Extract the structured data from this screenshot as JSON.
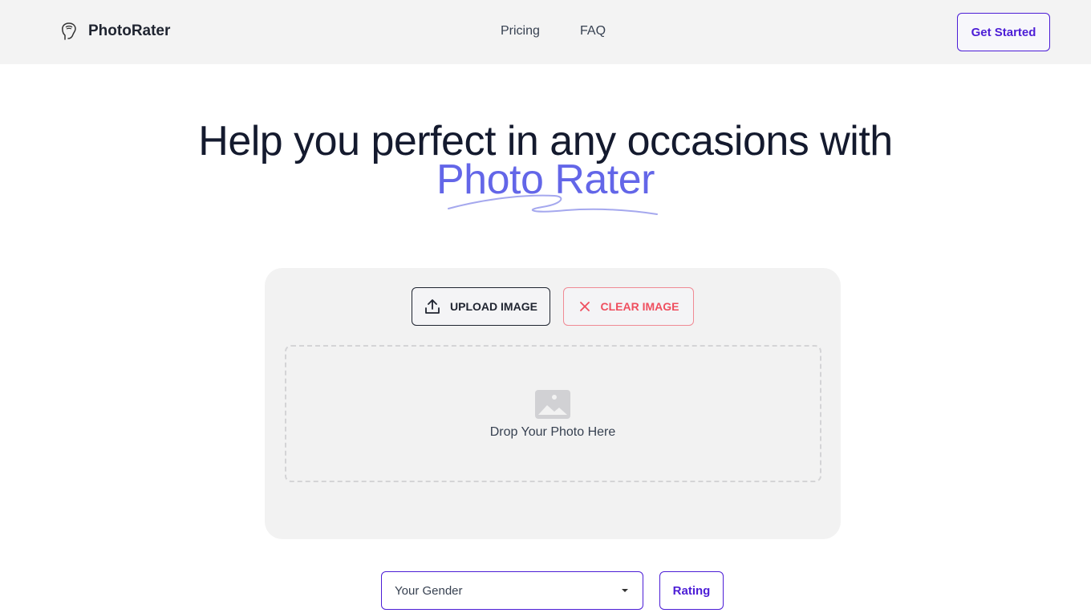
{
  "header": {
    "brand": "PhotoRater",
    "nav": [
      {
        "label": "Pricing"
      },
      {
        "label": "FAQ"
      }
    ],
    "cta_label": "Get Started"
  },
  "hero": {
    "line1": "Help you perfect in any occasions with",
    "accent": "Photo Rater"
  },
  "uploader": {
    "upload_label": "UPLOAD IMAGE",
    "clear_label": "CLEAR IMAGE",
    "drop_text": "Drop Your Photo Here"
  },
  "form": {
    "gender_selected": "Your Gender",
    "rating_label": "Rating"
  },
  "colors": {
    "accent": "#6366e8",
    "brand_purple": "#4c1dd6",
    "danger": "#ef4f5f"
  }
}
